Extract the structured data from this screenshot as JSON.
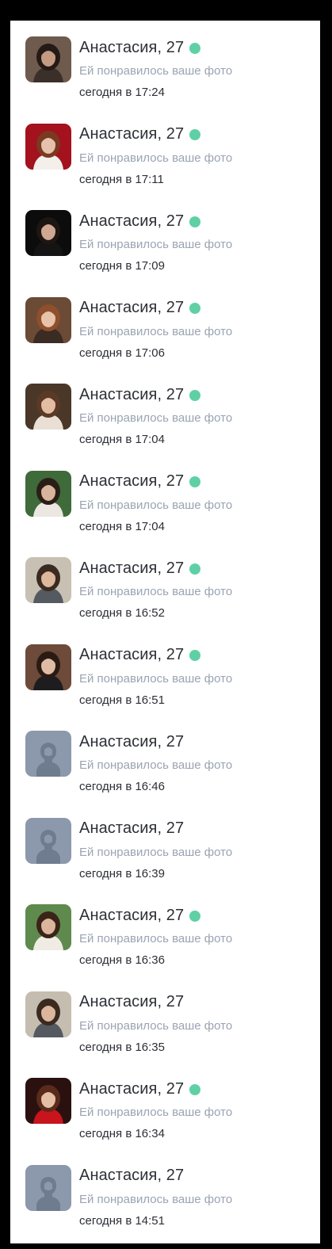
{
  "colors": {
    "online": "#5fd0a5",
    "name_text": "#2c2f36",
    "secondary_text": "#9aa4b2",
    "placeholder_avatar": "#8c98ab"
  },
  "notifications": [
    {
      "name": "Анастасия, 27",
      "action": "Ей понравилось ваше фото",
      "time": "сегодня в 17:24",
      "online": true,
      "photo": {
        "bg": "#6f5a4e",
        "hair": "#241a16",
        "skin": "#c49a82",
        "clothes": "#3b2f2a"
      }
    },
    {
      "name": "Анастасия, 27",
      "action": "Ей понравилось ваше фото",
      "time": "сегодня в 17:11",
      "online": true,
      "photo": {
        "bg": "#a3121d",
        "hair": "#7a3a22",
        "skin": "#e6c2ad",
        "clothes": "#f3efea"
      }
    },
    {
      "name": "Анастасия, 27",
      "action": "Ей понравилось ваше фото",
      "time": "сегодня в 17:09",
      "online": true,
      "photo": {
        "bg": "#0c0c0c",
        "hair": "#1e1612",
        "skin": "#cfa792",
        "clothes": "#141414"
      }
    },
    {
      "name": "Анастасия, 27",
      "action": "Ей понравилось ваше фото",
      "time": "сегодня в 17:06",
      "online": true,
      "photo": {
        "bg": "#6b4a36",
        "hair": "#8e4f2c",
        "skin": "#e7c3aa",
        "clothes": "#3a2b23"
      }
    },
    {
      "name": "Анастасия, 27",
      "action": "Ей понравилось ваше фото",
      "time": "сегодня в 17:04",
      "online": true,
      "photo": {
        "bg": "#4a3727",
        "hair": "#5a3a26",
        "skin": "#e3bda3",
        "clothes": "#e9dfd4"
      }
    },
    {
      "name": "Анастасия, 27",
      "action": "Ей понравилось ваше фото",
      "time": "сегодня в 17:04",
      "online": true,
      "photo": {
        "bg": "#3f6a3a",
        "hair": "#2a1d16",
        "skin": "#d8b49c",
        "clothes": "#ece7e0"
      }
    },
    {
      "name": "Анастасия, 27",
      "action": "Ей понравилось ваше фото",
      "time": "сегодня в 16:52",
      "online": true,
      "photo": {
        "bg": "#c8c0b2",
        "hair": "#3a2a20",
        "skin": "#dcb79c",
        "clothes": "#545a5f"
      }
    },
    {
      "name": "Анастасия, 27",
      "action": "Ей понравилось ваше фото",
      "time": "сегодня в 16:51",
      "online": true,
      "photo": {
        "bg": "#6d4a3a",
        "hair": "#2a1a14",
        "skin": "#e0bca4",
        "clothes": "#1d1d1f"
      }
    },
    {
      "name": "Анастасия, 27",
      "action": "Ей понравилось ваше фото",
      "time": "сегодня в 16:46",
      "online": false,
      "photo": null
    },
    {
      "name": "Анастасия, 27",
      "action": "Ей понравилось ваше фото",
      "time": "сегодня в 16:39",
      "online": false,
      "photo": null
    },
    {
      "name": "Анастасия, 27",
      "action": "Ей понравилось ваше фото",
      "time": "сегодня в 16:36",
      "online": true,
      "photo": {
        "bg": "#5f8a4e",
        "hair": "#3a2418",
        "skin": "#dcb69c",
        "clothes": "#f0ece4"
      }
    },
    {
      "name": "Анастасия, 27",
      "action": "Ей понравилось ваше фото",
      "time": "сегодня в 16:35",
      "online": false,
      "photo": {
        "bg": "#c5bdaf",
        "hair": "#3a2a20",
        "skin": "#dcb79c",
        "clothes": "#545a5f"
      }
    },
    {
      "name": "Анастасия, 27",
      "action": "Ей понравилось ваше фото",
      "time": "сегодня в 16:34",
      "online": true,
      "photo": {
        "bg": "#2a1110",
        "hair": "#5a2a1a",
        "skin": "#e4bfa6",
        "clothes": "#c8141c"
      }
    },
    {
      "name": "Анастасия, 27",
      "action": "Ей понравилось ваше фото",
      "time": "сегодня в 14:51",
      "online": false,
      "photo": null
    }
  ]
}
